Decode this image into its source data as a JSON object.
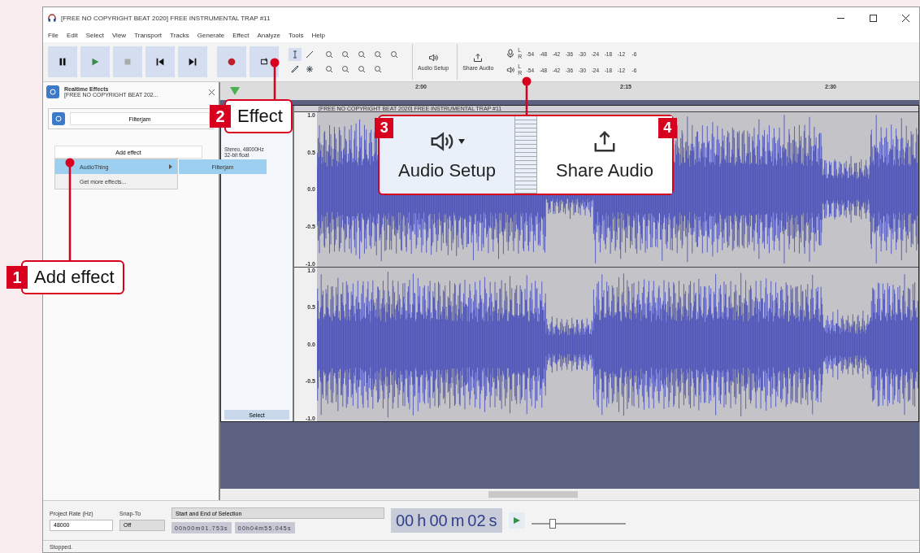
{
  "window": {
    "title": "[FREE NO COPYRIGHT BEAT 2020] FREE INSTRUMENTAL TRAP #11"
  },
  "menu": [
    "File",
    "Edit",
    "Select",
    "View",
    "Transport",
    "Tracks",
    "Generate",
    "Effect",
    "Analyze",
    "Tools",
    "Help"
  ],
  "toolbar": {
    "audio_setup": "Audio Setup",
    "share_audio": "Share Audio",
    "meters": [
      {
        "kind": "record",
        "channels": [
          "L",
          "R"
        ],
        "ticks": [
          "-54",
          "-48",
          "-42",
          "-36",
          "-30",
          "-24",
          "-18",
          "-12",
          "-6"
        ]
      },
      {
        "kind": "playback",
        "channels": [
          "L",
          "R"
        ],
        "ticks": [
          "-54",
          "-48",
          "-42",
          "-36",
          "-30",
          "-24",
          "-18",
          "-12",
          "-6"
        ]
      }
    ]
  },
  "ruler": [
    "2:00",
    "2:15",
    "2:30"
  ],
  "realtime_effects": {
    "title": "Realtime Effects",
    "subtitle": "[FREE NO COPYRIGHT BEAT 202...",
    "effect": "Filterjam",
    "add_effect": "Add effect",
    "menu": [
      {
        "label": "AudioThing",
        "submenu": true,
        "selected": true
      },
      {
        "label": "Get more effects...",
        "submenu": false,
        "selected": false
      }
    ],
    "submenu": [
      {
        "label": "Filterjam",
        "selected": true
      }
    ]
  },
  "track": {
    "name": "[FREE NO COPYRIGHT BEAT 2020] FREE INSTRUMENTAL TRAP #11",
    "info": [
      "Stereo, 48000Hz",
      "32-bit float"
    ],
    "select": "Select",
    "channels": [
      [
        "1.0",
        "0.5",
        "0.0",
        "-0.5",
        "-1.0"
      ],
      [
        "1.0",
        "0.5",
        "0.0",
        "-0.5",
        "-1.0"
      ]
    ]
  },
  "selection_bar": {
    "project_rate_label": "Project Rate (Hz)",
    "project_rate": "48000",
    "snap_label": "Snap-To",
    "snap": "Off",
    "selection_mode": "Start and End of Selection",
    "start": "00h00m01.753s",
    "end": "00h04m55.045s",
    "time": [
      "00",
      "h",
      "00",
      "m",
      "02",
      "s"
    ]
  },
  "speed_slider": {
    "level": 0.22
  },
  "status_bar": "Stopped.",
  "callouts": [
    {
      "number": "1",
      "label": "Add effect"
    },
    {
      "number": "2",
      "label": "Effect"
    }
  ],
  "inset": [
    {
      "number": "3",
      "label": "Audio Setup"
    },
    {
      "number": "4",
      "label": "Share Audio"
    }
  ]
}
